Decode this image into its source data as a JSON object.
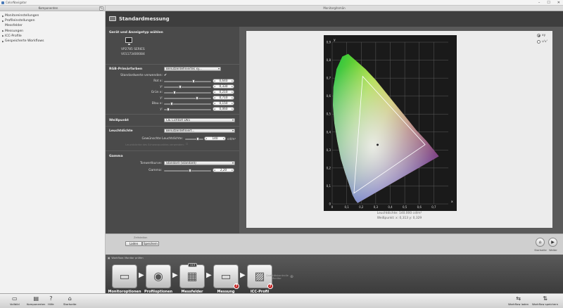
{
  "app": {
    "title": "ColorNavigator"
  },
  "main_window_title": "Monitorgitsmän",
  "left_panel": {
    "header": "Komponenten",
    "items": [
      {
        "label": "Monitoreinstellungen",
        "expandable": true
      },
      {
        "label": "Profileinstellungen",
        "expandable": true
      },
      {
        "label": "Messfelder",
        "expandable": false
      },
      {
        "label": "Messungen",
        "expandable": true
      },
      {
        "label": "ICC-Profile",
        "expandable": true
      },
      {
        "label": "Gespeicherte Workflows",
        "expandable": true
      }
    ]
  },
  "content": {
    "title": "Standardmessung",
    "device_section": {
      "title": "Gerät und Anzeigetyp wählen",
      "model": "VP2785 SERIES",
      "serial": "V01173400084"
    },
    "rgb_section": {
      "title": "RGB-Primärfarben",
      "dropdown": "Benutzerdefiniertes xy...",
      "use_standard_label": "Standardwerte verwenden:",
      "use_standard": true,
      "rows": [
        {
          "label": "Rot x:",
          "value": "0,640",
          "fraction": 0.64
        },
        {
          "label": "y:",
          "value": "0,330",
          "fraction": 0.33
        },
        {
          "label": "Grün x:",
          "value": "0,210",
          "fraction": 0.21
        },
        {
          "label": "y:",
          "value": "0,710",
          "fraction": 0.71
        },
        {
          "label": "Blau x:",
          "value": "0,150",
          "fraction": 0.15
        },
        {
          "label": "y:",
          "value": "0,060",
          "fraction": 0.06
        }
      ]
    },
    "whitepoint_section": {
      "title": "Weißpunkt",
      "dropdown": "CIE Lichtart D65"
    },
    "luminance_section": {
      "title": "Leuchtdichte",
      "dropdown": "Benutzerdefiniert...",
      "label": "Gewünschte Leuchtdichte:",
      "value": "140",
      "unit": "cd/m²",
      "faded_label": "Leuchtdichte des Schwarzpunktes verwenden:"
    },
    "gamma_section": {
      "title": "Gamma",
      "curve_label": "Tonwertkurve:",
      "curve_value": "Standard (Standard)",
      "gamma_label": "Gamma:",
      "gamma_value": "2,20",
      "gamma_fraction": 0.55
    }
  },
  "chart_options": [
    {
      "label": "xy",
      "selected": true
    },
    {
      "label": "u'v'",
      "selected": false
    }
  ],
  "chart_data": {
    "type": "scatter",
    "xlabel": "x",
    "ylabel": "y",
    "xlim": [
      0,
      0.8
    ],
    "ylim": [
      0,
      0.9
    ],
    "x_ticks": [
      "0",
      "0,1",
      "0,2",
      "0,3",
      "0,4",
      "0,5",
      "0,6",
      "0,7"
    ],
    "y_ticks": [
      "0",
      "0,1",
      "0,2",
      "0,3",
      "0,4",
      "0,5",
      "0,6",
      "0,7",
      "0,8",
      "0,9"
    ],
    "grid": true,
    "gamut_triangle": [
      [
        0.64,
        0.33
      ],
      [
        0.21,
        0.71
      ],
      [
        0.15,
        0.06
      ]
    ],
    "white_point": [
      0.313,
      0.329
    ],
    "caption_luminance": "Leuchtdichte: 140.000 cd/m²",
    "caption_whitepoint": "Weißpunkt: x: 0,313  y: 0,329"
  },
  "schedule": {
    "label": "Zeitstation",
    "load": "Laden",
    "save": "Speichern"
  },
  "nav_buttons": [
    {
      "label": "Startseite",
      "icon": "home-icon",
      "glyph": "⌂"
    },
    {
      "label": "Weiter",
      "icon": "play-icon",
      "glyph": "▶"
    }
  ],
  "workflow": {
    "title": "Workflow: Monitor prüfen",
    "steps": [
      {
        "label": "Monitoroptionen",
        "icon": "monitor-options-icon",
        "badge": ""
      },
      {
        "label": "Profiloptionen",
        "icon": "profile-options-icon",
        "badge": ""
      },
      {
        "label": "Messfelder",
        "icon": "patches-icon",
        "badge": "",
        "count": "113"
      },
      {
        "label": "Messung",
        "icon": "measurement-icon",
        "badge": "?"
      },
      {
        "label": "ICC-Profil",
        "icon": "icc-profile-icon",
        "badge": "?"
      }
    ],
    "faded_step": "Qualitätskontrolle Monitor"
  },
  "toolbar": {
    "left": [
      {
        "label": "Vollbild",
        "icon": "fullscreen-icon",
        "glyph": "▭"
      },
      {
        "label": "Komponenten",
        "icon": "components-icon",
        "glyph": "▤"
      },
      {
        "label": "Hilfe",
        "icon": "help-icon",
        "glyph": "?"
      },
      {
        "label": "Startseite",
        "icon": "home-icon",
        "glyph": "⌂"
      }
    ],
    "right": [
      {
        "label": "Workflow laden",
        "icon": "workflow-load-icon",
        "glyph": "⇆"
      },
      {
        "label": "Workflow speichern",
        "icon": "workflow-save-icon",
        "glyph": "⇅"
      }
    ]
  },
  "colors": {
    "panel_dark": "#4a4a4a",
    "header_dark": "#3e3e3e",
    "badge_red": "#c21e1e"
  }
}
